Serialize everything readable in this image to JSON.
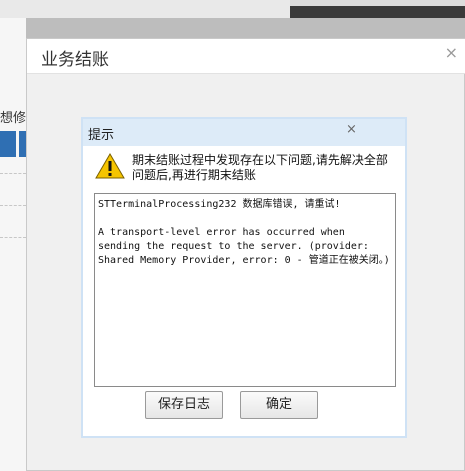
{
  "background": {
    "left_text": "想修"
  },
  "window": {
    "title": "业务结账",
    "close_glyph": "×"
  },
  "dialog": {
    "title": "提示",
    "close_glyph": "×",
    "message": "期末结账过程中发现存在以下问题,请先解决全部问题后,再进行期末结账",
    "error_text": "STTerminalProcessing232 数据库错误, 请重试!\n\nA transport-level error has occurred when sending the request to the server. (provider: Shared Memory Provider, error: 0 - 管道正在被关闭。)",
    "buttons": {
      "save_log": "保存日志",
      "ok": "确定"
    }
  },
  "colors": {
    "accent_blue": "#2f6fb3",
    "dialog_header": "#ddebf8",
    "warning_yellow": "#f5c400"
  },
  "icons": {
    "warning": "warning-icon",
    "close": "close-icon"
  }
}
